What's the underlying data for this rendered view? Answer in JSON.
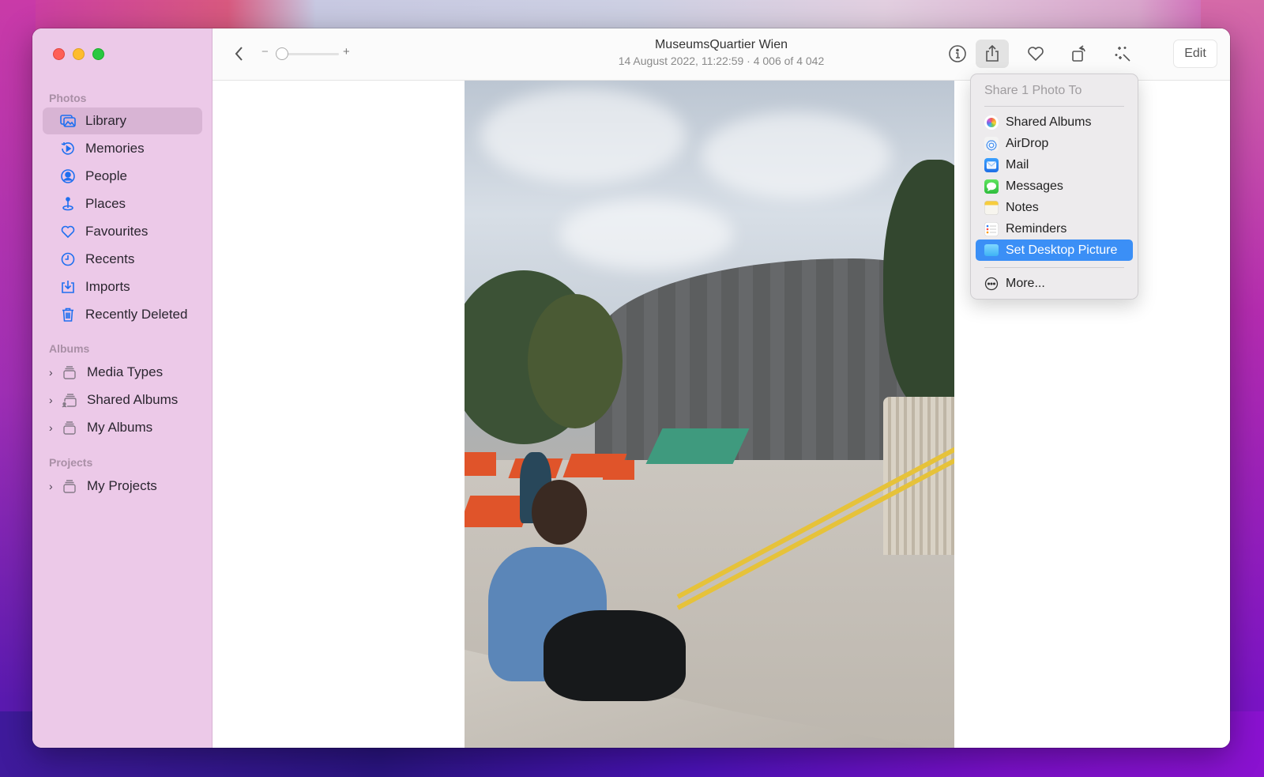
{
  "window": {
    "title": "MuseumsQuartier Wien",
    "subtitle": "14 August 2022, 11:22:59  ·  4 006 of 4 042"
  },
  "traffic_lights": [
    "close",
    "minimize",
    "maximize"
  ],
  "sidebar": {
    "sections": [
      {
        "label": "Photos",
        "items": [
          {
            "label": "Library",
            "icon": "library-icon",
            "selected": true
          },
          {
            "label": "Memories",
            "icon": "memories-icon"
          },
          {
            "label": "People",
            "icon": "people-icon"
          },
          {
            "label": "Places",
            "icon": "places-icon"
          },
          {
            "label": "Favourites",
            "icon": "heart-icon"
          },
          {
            "label": "Recents",
            "icon": "clock-icon"
          },
          {
            "label": "Imports",
            "icon": "import-icon"
          },
          {
            "label": "Recently Deleted",
            "icon": "trash-icon"
          }
        ]
      },
      {
        "label": "Albums",
        "items": [
          {
            "label": "Media Types",
            "icon": "album-stack-icon"
          },
          {
            "label": "Shared Albums",
            "icon": "shared-album-icon"
          },
          {
            "label": "My Albums",
            "icon": "album-stack-icon"
          }
        ]
      },
      {
        "label": "Projects",
        "items": [
          {
            "label": "My Projects",
            "icon": "album-stack-icon"
          }
        ]
      }
    ]
  },
  "toolbar": {
    "back_icon": "chevron-left-icon",
    "zoom_minus": "−",
    "zoom_plus": "+",
    "zoom_level": 0,
    "buttons": [
      "info-icon",
      "share-icon",
      "heart-icon",
      "rotate-icon",
      "magic-wand-icon"
    ],
    "edit_label": "Edit"
  },
  "share_menu": {
    "header": "Share 1 Photo To",
    "items": [
      {
        "label": "Shared Albums",
        "icon": "photos-app-icon",
        "color": "#f0a13a"
      },
      {
        "label": "AirDrop",
        "icon": "airdrop-icon",
        "color": "#4a90e2"
      },
      {
        "label": "Mail",
        "icon": "mail-icon",
        "color": "#2f8cf0"
      },
      {
        "label": "Messages",
        "icon": "messages-icon",
        "color": "#34c84a"
      },
      {
        "label": "Notes",
        "icon": "notes-icon",
        "color": "#f5d24a"
      },
      {
        "label": "Reminders",
        "icon": "reminders-icon",
        "color": "#ffffff"
      },
      {
        "label": "Set Desktop Picture",
        "icon": "desktop-picture-icon",
        "color": "#5ac8fa",
        "highlighted": true
      }
    ],
    "more_label": "More..."
  },
  "colors": {
    "accent": "#1e6ff0",
    "menu_highlight": "#3b8ff6",
    "sidebar_bg": "#ecc9e8"
  }
}
